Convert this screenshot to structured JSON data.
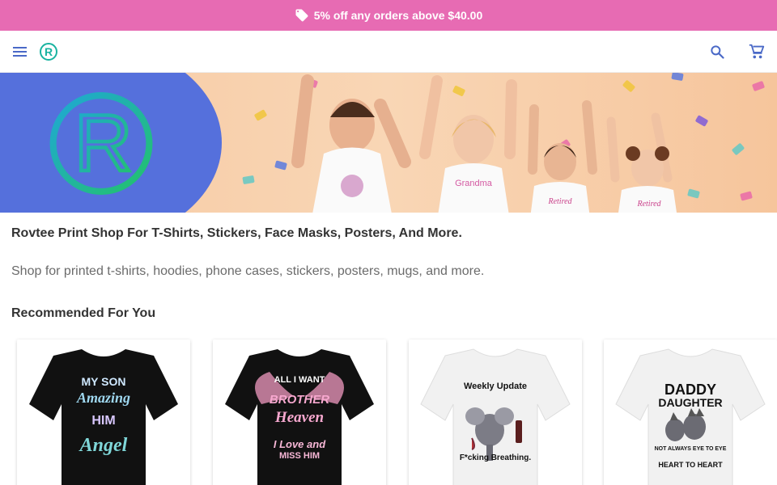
{
  "promo": {
    "text": "5% off any orders above $40.00",
    "icon": "tag-icon",
    "bg": "#e76bb3"
  },
  "header": {
    "menu_icon": "menu-icon",
    "logo_letter": "R",
    "search_icon": "search-icon",
    "cart_icon": "cart-icon",
    "accent": "#1aa8a0"
  },
  "hero": {
    "logo_letter": "R",
    "shirt_labels": [
      "Grandma",
      "Retired",
      "Retired"
    ]
  },
  "content": {
    "headline": "Rovtee Print Shop For T-Shirts, Stickers, Face Masks, Posters, And More.",
    "subline": "Shop for printed t-shirts, hoodies, phone cases, stickers, posters, mugs, and more.",
    "recommended_title": "Recommended For You"
  },
  "products": [
    {
      "color": "#111111",
      "lines": [
        "MY SON",
        "Amazing",
        "HIM",
        "Angel"
      ]
    },
    {
      "color": "#111111",
      "lines": [
        "ALL I WANT",
        "BROTHER",
        "Heaven",
        "I Love and",
        "MISS HIM"
      ]
    },
    {
      "color": "#f1f1f1",
      "lines": [
        "Weekly Update",
        "F*cking Breathing."
      ]
    },
    {
      "color": "#f1f1f1",
      "lines": [
        "DADDY",
        "DAUGHTER",
        "NOT ALWAYS EYE TO EYE",
        "HEART TO HEART"
      ]
    }
  ]
}
